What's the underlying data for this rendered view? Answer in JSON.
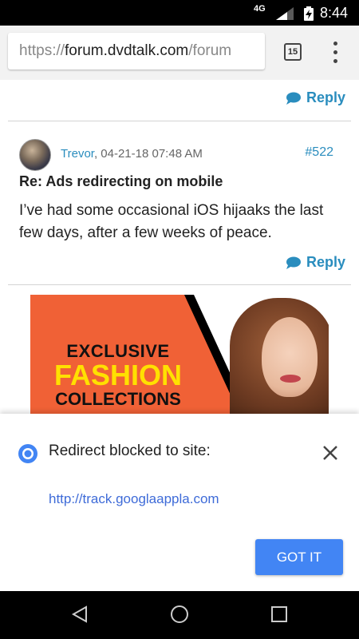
{
  "status": {
    "network": "4G",
    "time": "8:44"
  },
  "browser": {
    "url_scheme": "https://",
    "url_domain": "forum.dvdtalk.com",
    "url_path": "/forum",
    "tab_count": "15"
  },
  "posts": [
    {
      "reply_label": "Reply"
    },
    {
      "username": "Trevor",
      "date": ", 04-21-18 07:48 AM",
      "post_number": "#522",
      "title": "Re: Ads redirecting on mobile",
      "body": "I’ve had some occasional iOS hijaaks the last few days, after a few weeks of peace.",
      "reply_label": "Reply"
    }
  ],
  "ad": {
    "line1": "EXCLUSIVE",
    "line2": "FASHION",
    "line3": "COLLECTIONS"
  },
  "redirect_sheet": {
    "message": "Redirect blocked to site:",
    "url": "http://track.googlaappla.com",
    "button_label": "GOT IT"
  },
  "colors": {
    "accent": "#2a8dbe",
    "button": "#4285f4",
    "link": "#3e6bd8"
  }
}
